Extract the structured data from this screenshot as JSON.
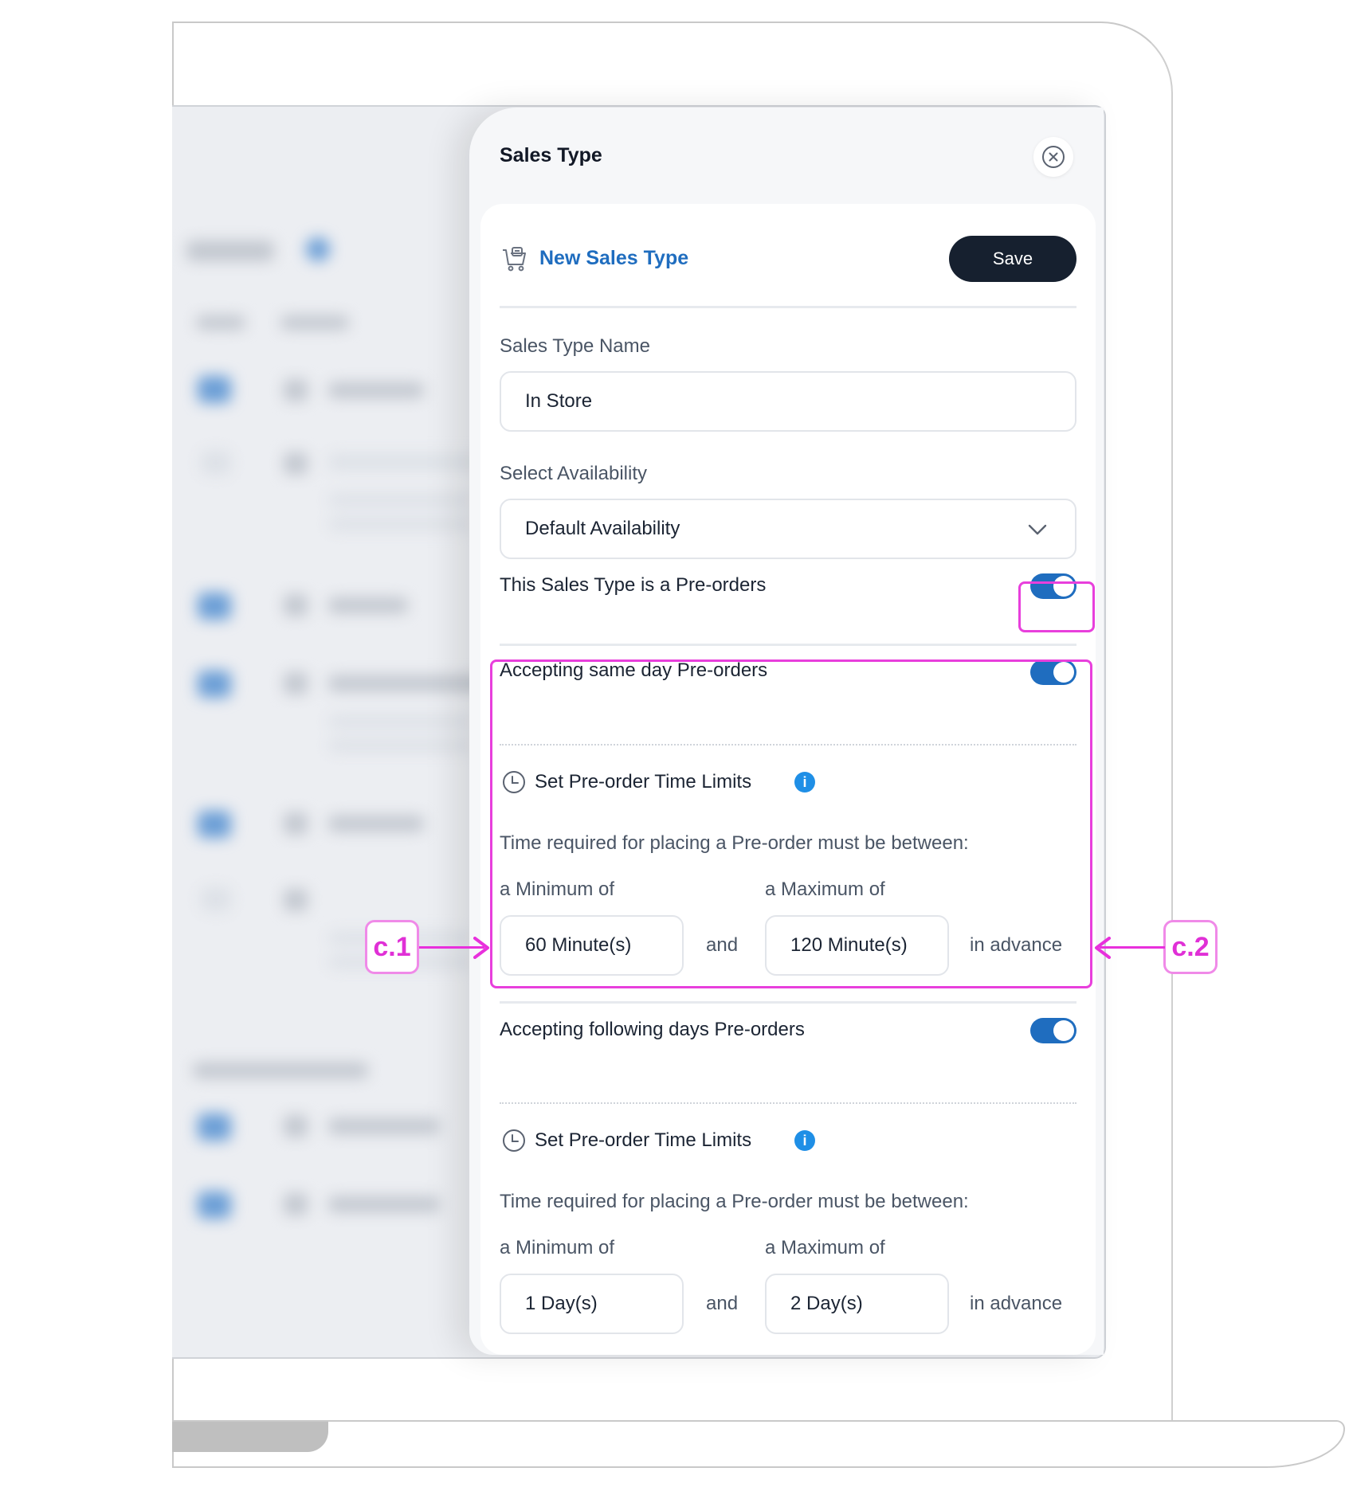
{
  "panel": {
    "title": "Sales Type",
    "header": {
      "title": "New Sales Type",
      "save_label": "Save"
    },
    "name_field": {
      "label": "Sales Type Name",
      "value": "In Store"
    },
    "availability": {
      "label": "Select Availability",
      "value": "Default Availability"
    },
    "preorder_toggle": {
      "label": "This Sales Type is a Pre-orders",
      "state": "on"
    },
    "same_day": {
      "label": "Accepting same day Pre-orders",
      "state": "on",
      "limits_title": "Set Pre-order Time Limits",
      "description": "Time required for placing a Pre-order must be between:",
      "min_label": "a Minimum of",
      "max_label": "a Maximum of",
      "min_value": "60 Minute(s)",
      "and": "and",
      "max_value": "120 Minute(s)",
      "suffix": "in advance"
    },
    "following_days": {
      "label": "Accepting following days Pre-orders",
      "state": "on",
      "limits_title": "Set Pre-order Time Limits",
      "description": "Time required for placing a Pre-order must be between:",
      "min_label": "a Minimum of",
      "max_label": "a Maximum of",
      "min_value": "1 Day(s)",
      "and": "and",
      "max_value": "2 Day(s)",
      "suffix": "in advance"
    }
  },
  "annotations": {
    "left_tag": "c.1",
    "right_tag": "c.2"
  },
  "info_glyph": "i",
  "colors": {
    "accent": "#1f6dbf",
    "save": "#16202f",
    "annotation": "#e83fdc"
  }
}
